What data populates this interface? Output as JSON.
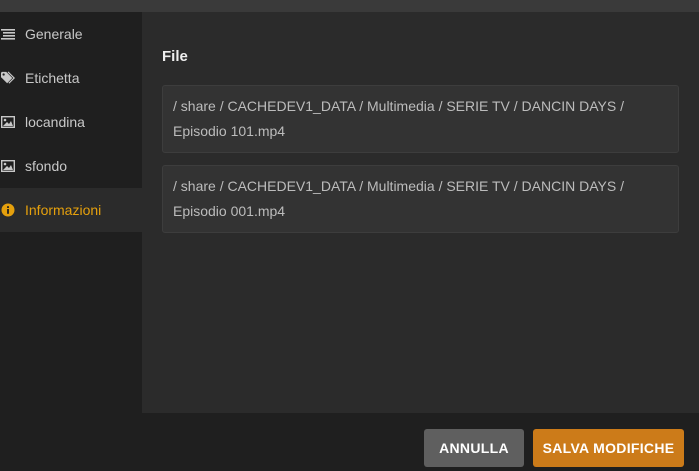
{
  "sidebar": {
    "items": [
      {
        "label": "Generale",
        "icon": "list-icon",
        "active": false
      },
      {
        "label": "Etichetta",
        "icon": "tag-icon",
        "active": false
      },
      {
        "label": "locandina",
        "icon": "image-icon",
        "active": false
      },
      {
        "label": "sfondo",
        "icon": "image-icon",
        "active": false
      },
      {
        "label": "Informazioni",
        "icon": "info-circle-icon",
        "active": true
      }
    ]
  },
  "main": {
    "section_title": "File",
    "files": [
      "/ share / CACHEDEV1_DATA / Multimedia / SERIE TV / DANCIN DAYS / Episodio 101.mp4",
      "/ share / CACHEDEV1_DATA / Multimedia / SERIE TV / DANCIN DAYS / Episodio 001.mp4"
    ]
  },
  "footer": {
    "cancel_label": "ANNULLA",
    "save_label": "SALVA MODIFICHE"
  },
  "colors": {
    "accent": "#e5a00d",
    "save_button": "#cc7b19",
    "cancel_button": "#5f5f5f"
  }
}
